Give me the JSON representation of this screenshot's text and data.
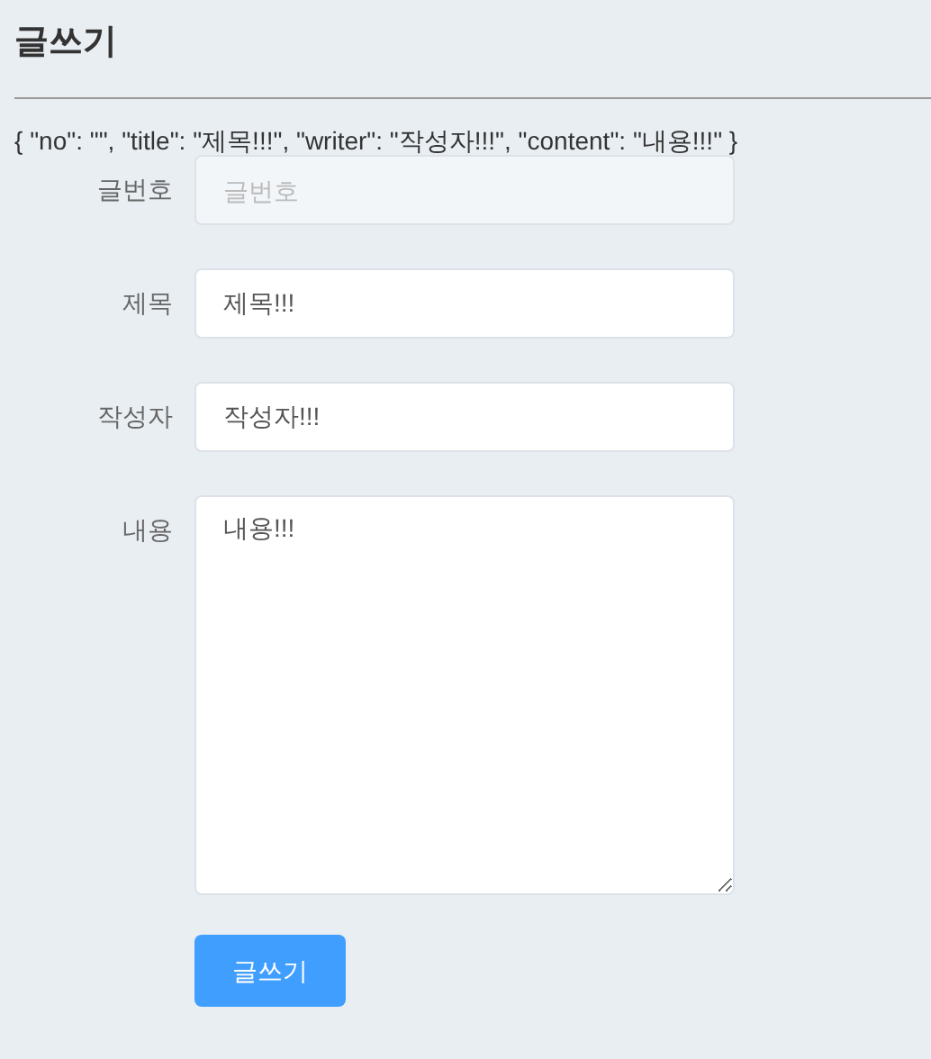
{
  "heading": "글쓰기",
  "debug_text": "{ \"no\": \"\", \"title\": \"제목!!!\", \"writer\": \"작성자!!!\", \"content\": \"내용!!!\" }",
  "fields": [
    {
      "kind": "input",
      "label": "글번호",
      "placeholder": "글번호",
      "disabled": true
    },
    {
      "kind": "input",
      "label": "제목",
      "value": "제목!!!",
      "disabled": false
    },
    {
      "kind": "input",
      "label": "작성자",
      "value": "작성자!!!",
      "disabled": false
    },
    {
      "kind": "textarea",
      "label": "내용",
      "value": "내용!!!",
      "disabled": false
    }
  ],
  "submit_button": "글쓰기"
}
